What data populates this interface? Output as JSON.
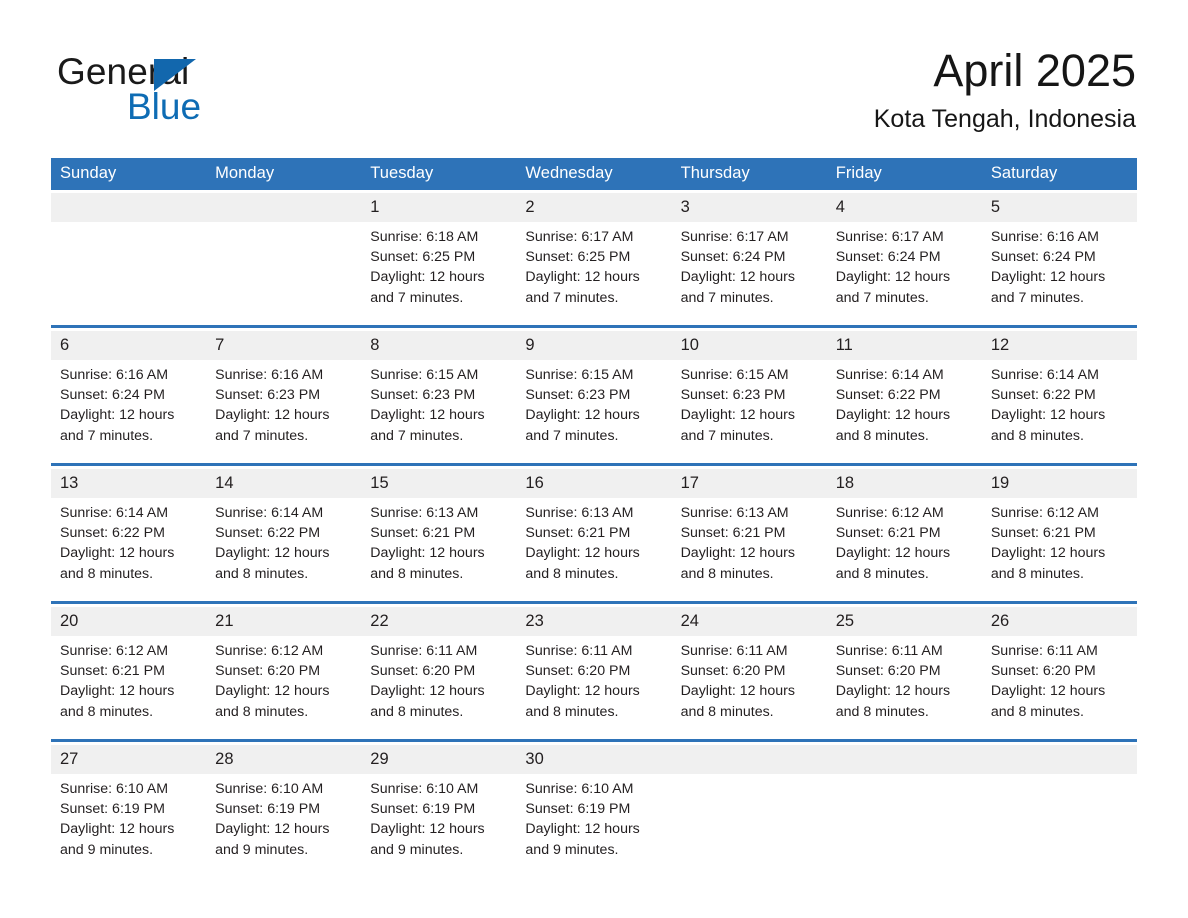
{
  "brand": {
    "name_part1": "General",
    "name_part2": "Blue",
    "triangle_color": "#1267ad",
    "blue_color": "#0e6cb4"
  },
  "header": {
    "month_title": "April 2025",
    "location": "Kota Tengah, Indonesia"
  },
  "theme": {
    "header_blue": "#2e73b8",
    "daynum_band": "#f0f0f0",
    "text": "#231f20"
  },
  "weekdays": [
    "Sunday",
    "Monday",
    "Tuesday",
    "Wednesday",
    "Thursday",
    "Friday",
    "Saturday"
  ],
  "weeks": [
    [
      {
        "day": "",
        "sunrise": "",
        "sunset": "",
        "daylight": "",
        "empty": true
      },
      {
        "day": "",
        "sunrise": "",
        "sunset": "",
        "daylight": "",
        "empty": true
      },
      {
        "day": "1",
        "sunrise": "Sunrise: 6:18 AM",
        "sunset": "Sunset: 6:25 PM",
        "daylight": "Daylight: 12 hours and 7 minutes."
      },
      {
        "day": "2",
        "sunrise": "Sunrise: 6:17 AM",
        "sunset": "Sunset: 6:25 PM",
        "daylight": "Daylight: 12 hours and 7 minutes."
      },
      {
        "day": "3",
        "sunrise": "Sunrise: 6:17 AM",
        "sunset": "Sunset: 6:24 PM",
        "daylight": "Daylight: 12 hours and 7 minutes."
      },
      {
        "day": "4",
        "sunrise": "Sunrise: 6:17 AM",
        "sunset": "Sunset: 6:24 PM",
        "daylight": "Daylight: 12 hours and 7 minutes."
      },
      {
        "day": "5",
        "sunrise": "Sunrise: 6:16 AM",
        "sunset": "Sunset: 6:24 PM",
        "daylight": "Daylight: 12 hours and 7 minutes."
      }
    ],
    [
      {
        "day": "6",
        "sunrise": "Sunrise: 6:16 AM",
        "sunset": "Sunset: 6:24 PM",
        "daylight": "Daylight: 12 hours and 7 minutes."
      },
      {
        "day": "7",
        "sunrise": "Sunrise: 6:16 AM",
        "sunset": "Sunset: 6:23 PM",
        "daylight": "Daylight: 12 hours and 7 minutes."
      },
      {
        "day": "8",
        "sunrise": "Sunrise: 6:15 AM",
        "sunset": "Sunset: 6:23 PM",
        "daylight": "Daylight: 12 hours and 7 minutes."
      },
      {
        "day": "9",
        "sunrise": "Sunrise: 6:15 AM",
        "sunset": "Sunset: 6:23 PM",
        "daylight": "Daylight: 12 hours and 7 minutes."
      },
      {
        "day": "10",
        "sunrise": "Sunrise: 6:15 AM",
        "sunset": "Sunset: 6:23 PM",
        "daylight": "Daylight: 12 hours and 7 minutes."
      },
      {
        "day": "11",
        "sunrise": "Sunrise: 6:14 AM",
        "sunset": "Sunset: 6:22 PM",
        "daylight": "Daylight: 12 hours and 8 minutes."
      },
      {
        "day": "12",
        "sunrise": "Sunrise: 6:14 AM",
        "sunset": "Sunset: 6:22 PM",
        "daylight": "Daylight: 12 hours and 8 minutes."
      }
    ],
    [
      {
        "day": "13",
        "sunrise": "Sunrise: 6:14 AM",
        "sunset": "Sunset: 6:22 PM",
        "daylight": "Daylight: 12 hours and 8 minutes."
      },
      {
        "day": "14",
        "sunrise": "Sunrise: 6:14 AM",
        "sunset": "Sunset: 6:22 PM",
        "daylight": "Daylight: 12 hours and 8 minutes."
      },
      {
        "day": "15",
        "sunrise": "Sunrise: 6:13 AM",
        "sunset": "Sunset: 6:21 PM",
        "daylight": "Daylight: 12 hours and 8 minutes."
      },
      {
        "day": "16",
        "sunrise": "Sunrise: 6:13 AM",
        "sunset": "Sunset: 6:21 PM",
        "daylight": "Daylight: 12 hours and 8 minutes."
      },
      {
        "day": "17",
        "sunrise": "Sunrise: 6:13 AM",
        "sunset": "Sunset: 6:21 PM",
        "daylight": "Daylight: 12 hours and 8 minutes."
      },
      {
        "day": "18",
        "sunrise": "Sunrise: 6:12 AM",
        "sunset": "Sunset: 6:21 PM",
        "daylight": "Daylight: 12 hours and 8 minutes."
      },
      {
        "day": "19",
        "sunrise": "Sunrise: 6:12 AM",
        "sunset": "Sunset: 6:21 PM",
        "daylight": "Daylight: 12 hours and 8 minutes."
      }
    ],
    [
      {
        "day": "20",
        "sunrise": "Sunrise: 6:12 AM",
        "sunset": "Sunset: 6:21 PM",
        "daylight": "Daylight: 12 hours and 8 minutes."
      },
      {
        "day": "21",
        "sunrise": "Sunrise: 6:12 AM",
        "sunset": "Sunset: 6:20 PM",
        "daylight": "Daylight: 12 hours and 8 minutes."
      },
      {
        "day": "22",
        "sunrise": "Sunrise: 6:11 AM",
        "sunset": "Sunset: 6:20 PM",
        "daylight": "Daylight: 12 hours and 8 minutes."
      },
      {
        "day": "23",
        "sunrise": "Sunrise: 6:11 AM",
        "sunset": "Sunset: 6:20 PM",
        "daylight": "Daylight: 12 hours and 8 minutes."
      },
      {
        "day": "24",
        "sunrise": "Sunrise: 6:11 AM",
        "sunset": "Sunset: 6:20 PM",
        "daylight": "Daylight: 12 hours and 8 minutes."
      },
      {
        "day": "25",
        "sunrise": "Sunrise: 6:11 AM",
        "sunset": "Sunset: 6:20 PM",
        "daylight": "Daylight: 12 hours and 8 minutes."
      },
      {
        "day": "26",
        "sunrise": "Sunrise: 6:11 AM",
        "sunset": "Sunset: 6:20 PM",
        "daylight": "Daylight: 12 hours and 8 minutes."
      }
    ],
    [
      {
        "day": "27",
        "sunrise": "Sunrise: 6:10 AM",
        "sunset": "Sunset: 6:19 PM",
        "daylight": "Daylight: 12 hours and 9 minutes."
      },
      {
        "day": "28",
        "sunrise": "Sunrise: 6:10 AM",
        "sunset": "Sunset: 6:19 PM",
        "daylight": "Daylight: 12 hours and 9 minutes."
      },
      {
        "day": "29",
        "sunrise": "Sunrise: 6:10 AM",
        "sunset": "Sunset: 6:19 PM",
        "daylight": "Daylight: 12 hours and 9 minutes."
      },
      {
        "day": "30",
        "sunrise": "Sunrise: 6:10 AM",
        "sunset": "Sunset: 6:19 PM",
        "daylight": "Daylight: 12 hours and 9 minutes."
      },
      {
        "day": "",
        "sunrise": "",
        "sunset": "",
        "daylight": "",
        "empty": true
      },
      {
        "day": "",
        "sunrise": "",
        "sunset": "",
        "daylight": "",
        "empty": true
      },
      {
        "day": "",
        "sunrise": "",
        "sunset": "",
        "daylight": "",
        "empty": true
      }
    ]
  ]
}
